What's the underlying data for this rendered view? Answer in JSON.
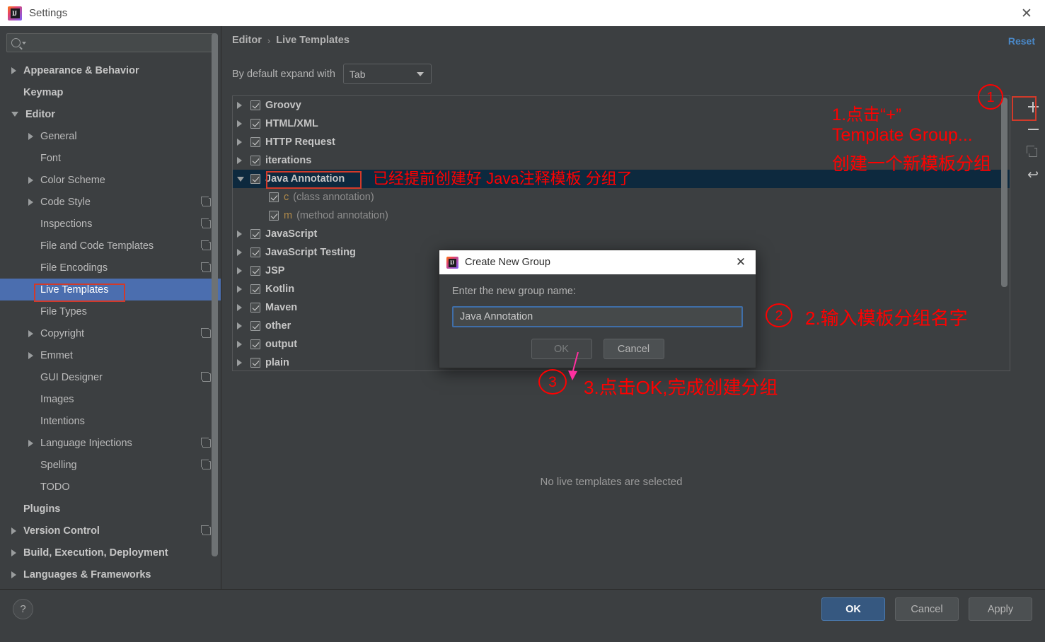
{
  "window": {
    "title": "Settings",
    "close_icon": "close-icon",
    "logo_icon": "intellij-logo-icon"
  },
  "sidebar": {
    "search": {
      "placeholder": "",
      "value": "",
      "icon": "search-icon"
    },
    "items": [
      {
        "label": "Appearance & Behavior",
        "level": 0,
        "twisty": "collapsed",
        "bold": true,
        "badge": false
      },
      {
        "label": "Keymap",
        "level": 0,
        "twisty": "none",
        "bold": true,
        "badge": false
      },
      {
        "label": "Editor",
        "level": 0,
        "twisty": "expanded",
        "bold": true,
        "badge": false
      },
      {
        "label": "General",
        "level": 1,
        "twisty": "collapsed",
        "bold": false,
        "badge": false
      },
      {
        "label": "Font",
        "level": 1,
        "twisty": "none",
        "bold": false,
        "badge": false
      },
      {
        "label": "Color Scheme",
        "level": 1,
        "twisty": "collapsed",
        "bold": false,
        "badge": false
      },
      {
        "label": "Code Style",
        "level": 1,
        "twisty": "collapsed",
        "bold": false,
        "badge": true
      },
      {
        "label": "Inspections",
        "level": 1,
        "twisty": "none",
        "bold": false,
        "badge": true
      },
      {
        "label": "File and Code Templates",
        "level": 1,
        "twisty": "none",
        "bold": false,
        "badge": true
      },
      {
        "label": "File Encodings",
        "level": 1,
        "twisty": "none",
        "bold": false,
        "badge": true
      },
      {
        "label": "Live Templates",
        "level": 1,
        "twisty": "none",
        "bold": false,
        "badge": false,
        "selected": true
      },
      {
        "label": "File Types",
        "level": 1,
        "twisty": "none",
        "bold": false,
        "badge": false
      },
      {
        "label": "Copyright",
        "level": 1,
        "twisty": "collapsed",
        "bold": false,
        "badge": true
      },
      {
        "label": "Emmet",
        "level": 1,
        "twisty": "collapsed",
        "bold": false,
        "badge": false
      },
      {
        "label": "GUI Designer",
        "level": 1,
        "twisty": "none",
        "bold": false,
        "badge": true
      },
      {
        "label": "Images",
        "level": 1,
        "twisty": "none",
        "bold": false,
        "badge": false
      },
      {
        "label": "Intentions",
        "level": 1,
        "twisty": "none",
        "bold": false,
        "badge": false
      },
      {
        "label": "Language Injections",
        "level": 1,
        "twisty": "collapsed",
        "bold": false,
        "badge": true
      },
      {
        "label": "Spelling",
        "level": 1,
        "twisty": "none",
        "bold": false,
        "badge": true
      },
      {
        "label": "TODO",
        "level": 1,
        "twisty": "none",
        "bold": false,
        "badge": false
      },
      {
        "label": "Plugins",
        "level": 0,
        "twisty": "none",
        "bold": true,
        "badge": false
      },
      {
        "label": "Version Control",
        "level": 0,
        "twisty": "collapsed",
        "bold": true,
        "badge": true
      },
      {
        "label": "Build, Execution, Deployment",
        "level": 0,
        "twisty": "collapsed",
        "bold": true,
        "badge": false
      },
      {
        "label": "Languages & Frameworks",
        "level": 0,
        "twisty": "collapsed",
        "bold": true,
        "badge": false
      }
    ]
  },
  "main": {
    "breadcrumb": {
      "parent": "Editor",
      "separator": "›",
      "current": "Live Templates"
    },
    "reset_label": "Reset",
    "expand_with": {
      "label": "By default expand with",
      "value": "Tab"
    },
    "empty_state": "No live templates are selected",
    "templates": [
      {
        "name": "Groovy",
        "twisty": "collapsed",
        "checked": true,
        "child": false
      },
      {
        "name": "HTML/XML",
        "twisty": "collapsed",
        "checked": true,
        "child": false
      },
      {
        "name": "HTTP Request",
        "twisty": "collapsed",
        "checked": true,
        "child": false
      },
      {
        "name": "iterations",
        "twisty": "collapsed",
        "checked": true,
        "child": false
      },
      {
        "name": "Java Annotation",
        "twisty": "expanded",
        "checked": true,
        "child": false,
        "selected": true
      },
      {
        "name": "c",
        "desc": "(class annotation)",
        "twisty": "none",
        "checked": true,
        "child": true
      },
      {
        "name": "m",
        "desc": "(method annotation)",
        "twisty": "none",
        "checked": true,
        "child": true
      },
      {
        "name": "JavaScript",
        "twisty": "collapsed",
        "checked": true,
        "child": false
      },
      {
        "name": "JavaScript Testing",
        "twisty": "collapsed",
        "checked": true,
        "child": false
      },
      {
        "name": "JSP",
        "twisty": "collapsed",
        "checked": true,
        "child": false
      },
      {
        "name": "Kotlin",
        "twisty": "collapsed",
        "checked": true,
        "child": false
      },
      {
        "name": "Maven",
        "twisty": "collapsed",
        "checked": true,
        "child": false
      },
      {
        "name": "other",
        "twisty": "collapsed",
        "checked": true,
        "child": false
      },
      {
        "name": "output",
        "twisty": "collapsed",
        "checked": true,
        "child": false
      },
      {
        "name": "plain",
        "twisty": "collapsed",
        "checked": true,
        "child": false
      }
    ],
    "toolbar": [
      {
        "icon": "plus-icon",
        "name": "add-template-button"
      },
      {
        "icon": "minus-icon",
        "name": "remove-template-button"
      },
      {
        "icon": "copy-icon",
        "name": "duplicate-template-button"
      },
      {
        "icon": "revert-icon",
        "name": "revert-template-button"
      }
    ]
  },
  "dialog": {
    "title": "Create New Group",
    "prompt": "Enter the new group name:",
    "input_value": "Java Annotation",
    "ok_label": "OK",
    "cancel_label": "Cancel",
    "close_icon": "close-icon"
  },
  "footer": {
    "help_icon": "?",
    "ok_label": "OK",
    "cancel_label": "Cancel",
    "apply_label": "Apply"
  },
  "annotations": {
    "color": "#ff0000",
    "highlight_color": "#d13a2a",
    "arrow_color": "#ff2fa0",
    "step1": {
      "badge": "1",
      "line1": "1.点击“+”",
      "line2": "Template Group...",
      "line3": "创建一个新模板分组"
    },
    "step2": {
      "badge": "2",
      "text": "2.输入模板分组名字"
    },
    "step3": {
      "badge": "3",
      "text": "3.点击OK,完成创建分组"
    },
    "note_group": "已经提前创建好 Java注释模板 分组了"
  }
}
